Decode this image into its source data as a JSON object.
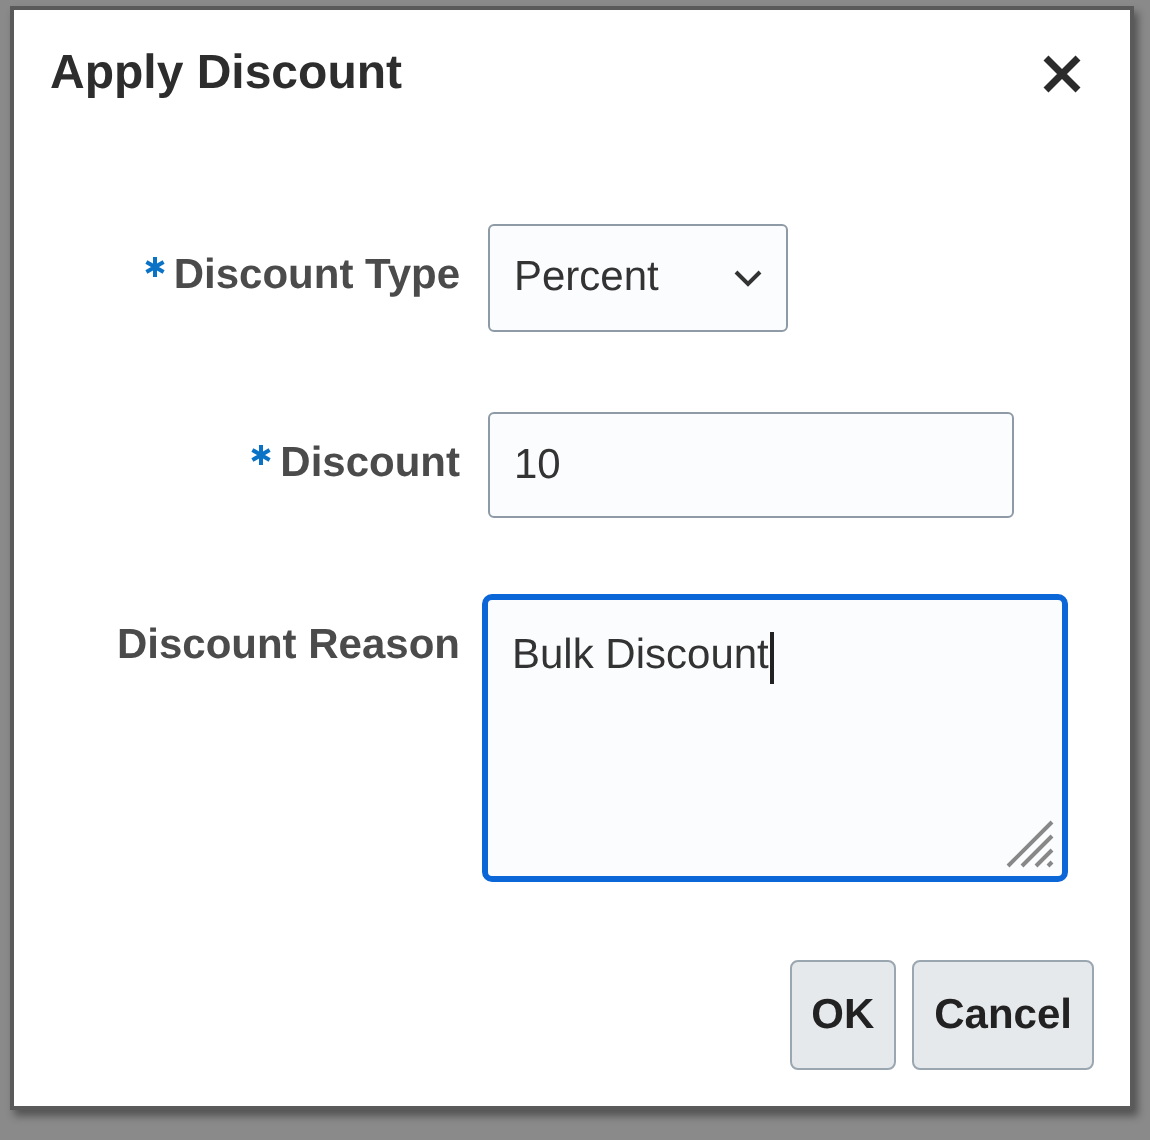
{
  "dialog": {
    "title": "Apply Discount"
  },
  "fields": [
    {
      "kind": "select",
      "label": "Discount Type",
      "required": true,
      "value": "Percent",
      "focused": false
    },
    {
      "kind": "input",
      "label": "Discount",
      "required": true,
      "value": "10",
      "focused": false
    },
    {
      "kind": "textarea",
      "label": "Discount Reason",
      "required": false,
      "value": "Bulk Discount",
      "focused": true
    }
  ],
  "buttons": [
    {
      "label": "OK"
    },
    {
      "label": "Cancel"
    }
  ]
}
